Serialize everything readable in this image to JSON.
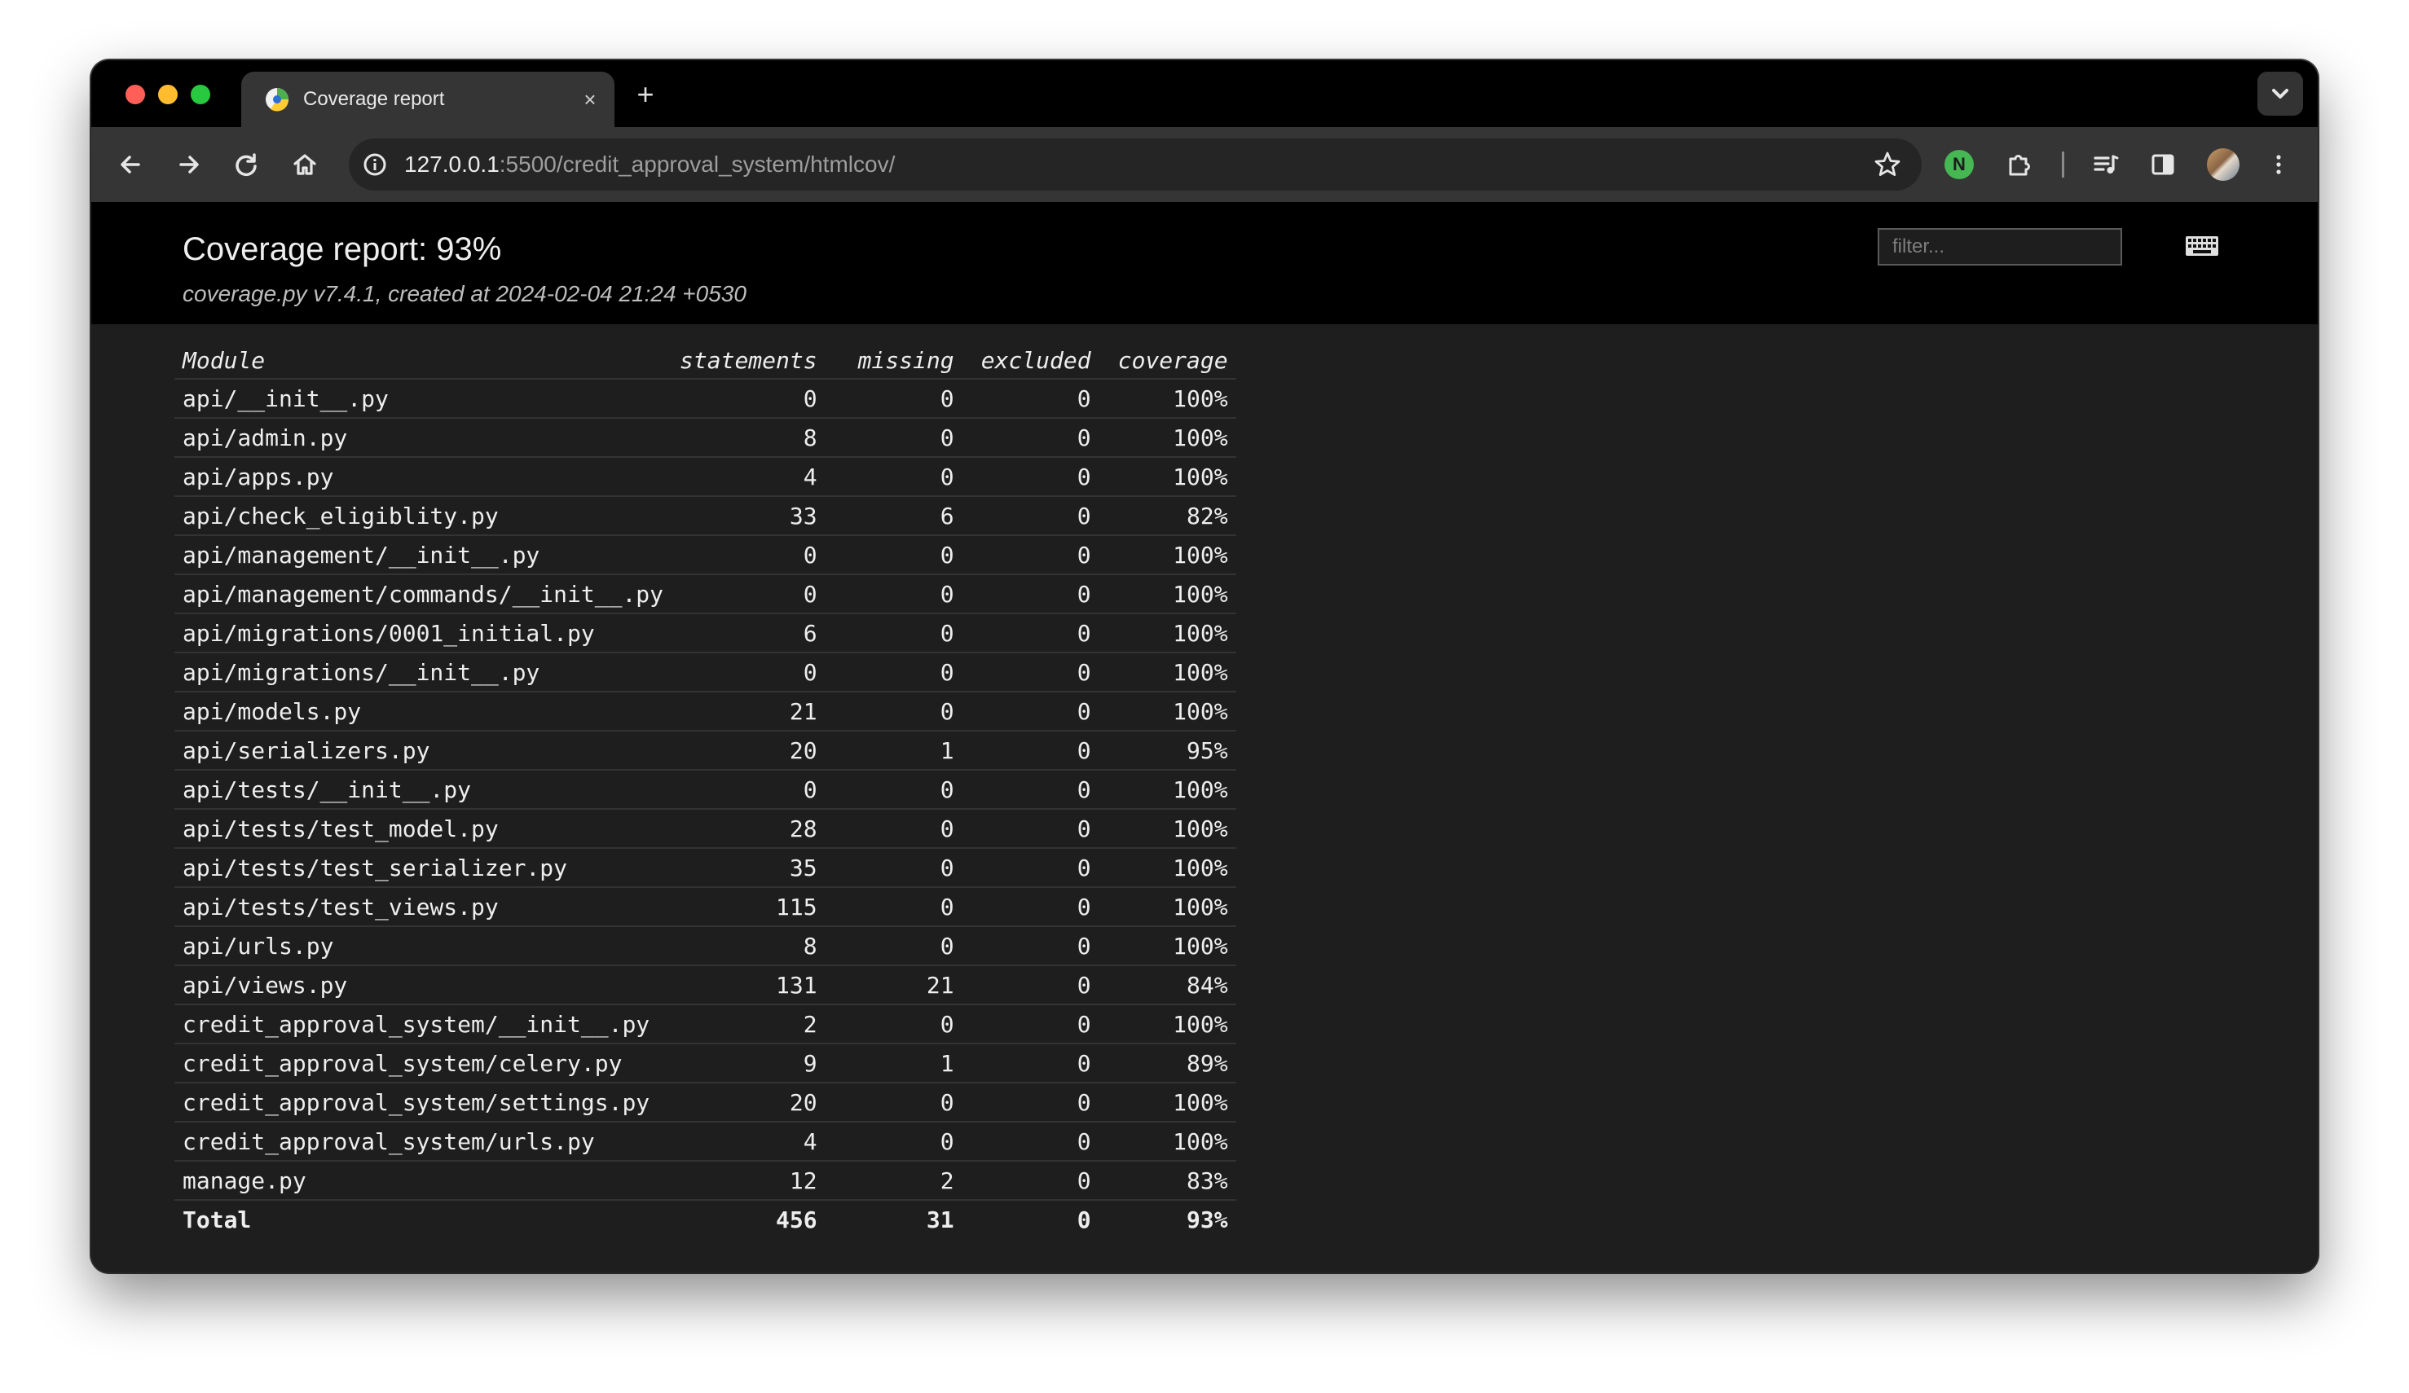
{
  "browser": {
    "tab": {
      "title": "Coverage report",
      "close_glyph": "×"
    },
    "new_tab_glyph": "+",
    "address": {
      "host": "127.0.0.1",
      "path": ":5500/credit_approval_system/htmlcov/"
    },
    "extension_badge": "N",
    "icons": [
      "back-arrow-icon",
      "forward-arrow-icon",
      "reload-icon",
      "home-icon",
      "site-info-icon",
      "bookmark-star-icon",
      "extensions-puzzle-icon",
      "media-queue-icon",
      "side-panel-icon",
      "profile-avatar",
      "kebab-menu-icon",
      "tab-search-chevron-icon"
    ]
  },
  "report": {
    "title": "Coverage report: 93%",
    "meta": "coverage.py v7.4.1, created at 2024-02-04 21:24 +0530",
    "filter_placeholder": "filter...",
    "columns": [
      "Module",
      "statements",
      "missing",
      "excluded",
      "coverage"
    ],
    "rows": [
      [
        "api/__init__.py",
        "0",
        "0",
        "0",
        "100%"
      ],
      [
        "api/admin.py",
        "8",
        "0",
        "0",
        "100%"
      ],
      [
        "api/apps.py",
        "4",
        "0",
        "0",
        "100%"
      ],
      [
        "api/check_eligiblity.py",
        "33",
        "6",
        "0",
        "82%"
      ],
      [
        "api/management/__init__.py",
        "0",
        "0",
        "0",
        "100%"
      ],
      [
        "api/management/commands/__init__.py",
        "0",
        "0",
        "0",
        "100%"
      ],
      [
        "api/migrations/0001_initial.py",
        "6",
        "0",
        "0",
        "100%"
      ],
      [
        "api/migrations/__init__.py",
        "0",
        "0",
        "0",
        "100%"
      ],
      [
        "api/models.py",
        "21",
        "0",
        "0",
        "100%"
      ],
      [
        "api/serializers.py",
        "20",
        "1",
        "0",
        "95%"
      ],
      [
        "api/tests/__init__.py",
        "0",
        "0",
        "0",
        "100%"
      ],
      [
        "api/tests/test_model.py",
        "28",
        "0",
        "0",
        "100%"
      ],
      [
        "api/tests/test_serializer.py",
        "35",
        "0",
        "0",
        "100%"
      ],
      [
        "api/tests/test_views.py",
        "115",
        "0",
        "0",
        "100%"
      ],
      [
        "api/urls.py",
        "8",
        "0",
        "0",
        "100%"
      ],
      [
        "api/views.py",
        "131",
        "21",
        "0",
        "84%"
      ],
      [
        "credit_approval_system/__init__.py",
        "2",
        "0",
        "0",
        "100%"
      ],
      [
        "credit_approval_system/celery.py",
        "9",
        "1",
        "0",
        "89%"
      ],
      [
        "credit_approval_system/settings.py",
        "20",
        "0",
        "0",
        "100%"
      ],
      [
        "credit_approval_system/urls.py",
        "4",
        "0",
        "0",
        "100%"
      ],
      [
        "manage.py",
        "12",
        "2",
        "0",
        "83%"
      ]
    ],
    "total": [
      "Total",
      "456",
      "31",
      "0",
      "93%"
    ]
  }
}
